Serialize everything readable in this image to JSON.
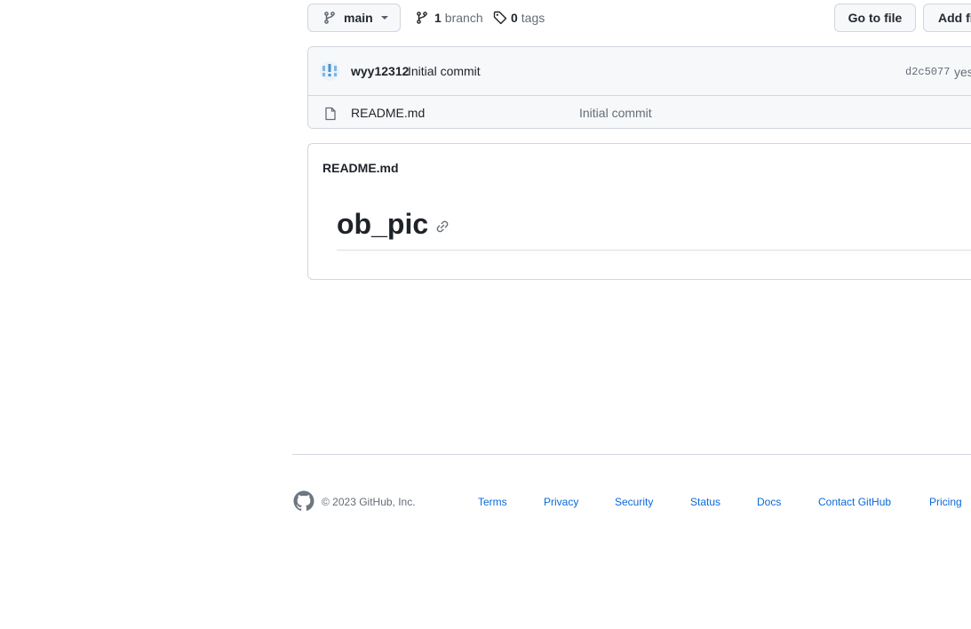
{
  "toolbar": {
    "branch_selector": "main",
    "branches_count": "1",
    "branches_label": "branch",
    "tags_count": "0",
    "tags_label": "tags",
    "goto_file": "Go to file",
    "add_file": "Add file"
  },
  "latest_commit": {
    "author": "wyy12312",
    "message": "Initial commit",
    "sha": "d2c5077",
    "time": "yesterday"
  },
  "files": [
    {
      "name": "README.md",
      "commit_message": "Initial commit"
    }
  ],
  "readme": {
    "filename": "README.md",
    "heading": "ob_pic"
  },
  "footer": {
    "copyright": "© 2023 GitHub, Inc.",
    "links": [
      "Terms",
      "Privacy",
      "Security",
      "Status",
      "Docs",
      "Contact GitHub",
      "Pricing"
    ]
  },
  "icons": [
    "branch-icon",
    "caret-down-icon",
    "tag-icon",
    "avatar-icon",
    "file-icon",
    "link-icon",
    "github-logo-icon"
  ],
  "colors": {
    "link": "#0969da",
    "border": "#d0d7de",
    "muted": "#656d76",
    "button_bg": "#f6f8fa"
  }
}
